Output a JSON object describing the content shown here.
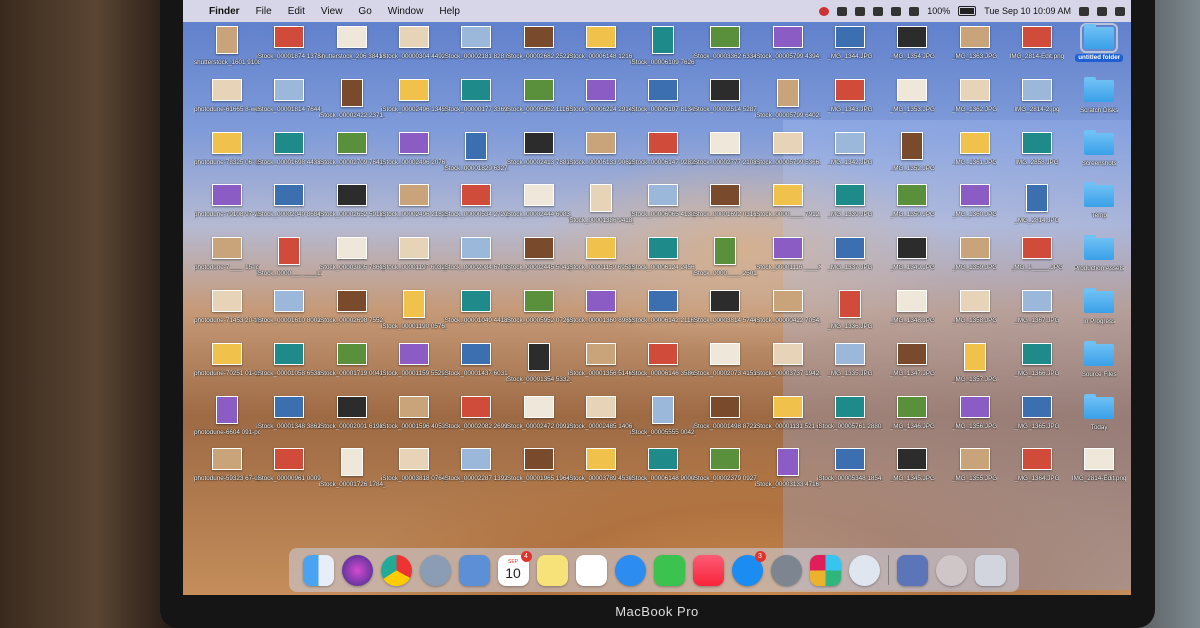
{
  "menubar": {
    "apple": "",
    "app": "Finder",
    "items": [
      "File",
      "Edit",
      "View",
      "Go",
      "Window",
      "Help"
    ],
    "battery": "100%",
    "clock": "Tue Sep 10 10:09 AM"
  },
  "desktop": {
    "columns": [
      [
        "shutterstock_1601 91080.jpg",
        "photodune-61665 8-wood-m.jpg",
        "photodune-78325 06-man...ck-m.jpg",
        "photodune-79108 97-wood-m.jpg",
        "photodune-7____ 15-lcd-t...en-l.jpg",
        "photodune-71453 20-tren...ds-m.jpg",
        "photodune-70251 01-dolla...nd-s.jpg",
        "photodune-6604 091-pc-...rd-s.jpg",
        "photodune-59323 67-olde...st-s.jpg"
      ],
      [
        "iStock_00001874 1378_Full.jpg",
        "iStock_00001814 7644_Large.jpg",
        "iStock_00001698 4438_Full.jpg",
        "iStock_00002040 8684_Full.jpg",
        "iStock_0000___ ____Large.jpg",
        "iStock_00001610 8002_X...arge.jpg",
        "iStock_00001058 6538_X...arge.jpg",
        "iStock_00001348 3862_X...arge.jpg",
        "iStock_00000961 0009_Full.jpg"
      ],
      [
        "shutterstock_206 384140.jpg",
        "iStock_00002422 2371_Large.jpg",
        "iStock_00002709 7641_Full.jpg",
        "iStock_00002652 5918_Full.jpg",
        "iStock_00003005 7860_Large.jpg",
        "iStock_00002698 7552_Full.jpg",
        "iStock_00001719 0041_Large.jpg",
        "iStock_00002001 6198_Full.jpg",
        "iStock_00001726 1784_Full.jpg"
      ],
      [
        "iStock_00000304 4492_Large.jpg",
        "iStock_00002496 1345_X...Large.jpg",
        "iStock_00002496 2076_X...Large.jpg",
        "iStock_00002496 2183_X...Large.jpg",
        "iStock_00001197 6032_Double.jpg",
        "iStock_00001190 0576_Double.jpg",
        "iStock_00001159 5529_Full.jpg",
        "iStock_00001596 4053_Double.jpg",
        "iStock_00003818 0764_Full.jpg"
      ],
      [
        "iStock_00002181 828_Double.jpg",
        "iStock_00000177 3369_Full.jpg",
        "iStock_00001829 6327_Large.jpg",
        "iStock_00000534 2720_Large.jpg",
        "iStock_00002084 6708_Full.jpg",
        "iStock_00001049 4418_Large.jpg",
        "iStock_00001437 6031_X...arge.jpg",
        "iStock_00002082 2699_Double.jpg",
        "iStock_00002287 1392_Full.jpg"
      ],
      [
        "iStock_00002682 2522_Large.jpg",
        "iStock_00005952 1116_Full.jpg",
        "iStock_00002413 7881_Medium.jpg",
        "iStock_00002444 6083_Medium.jpg",
        "iStock_00002445 5043_Medium.jpg",
        "iStock_00005952 0726_Full.jpg",
        "iStock_00001354 5332_Full.jpg",
        "iStock_00002472 0992_Large.jpg",
        "iStock_00001965 1964_Large.jpg"
      ],
      [
        "iStock_00006148 1216_XX...arge.jpg",
        "iStock_00006224 2914_Large.jpg",
        "iStock_00006133 9062_X...arge.jpg",
        "iStock_00001386 9418_X...Large.jpg",
        "iStock_00001159 6958_Large.jpg",
        "iStock_00001360 8985_Large.jpg",
        "iStock_00001356 5146_X...Large.jpg",
        "iStock_00002485 1406_X...Large.jpg",
        "iStock_00003789 4530_Double.jpg"
      ],
      [
        "iStock_00006109 7626_Double.jpg",
        "iStock_00006107 8134_X...arge.jpg",
        "iStock_00006147 9282_Full.jpg",
        "iStock_00006065 4138_Full.jpg",
        "iStock_00006124 2456_Full.jpg",
        "iStock_00006142 2116_Double.jpg",
        "iStock_00006146 3586_Large.jpg",
        "iStock_00005555 0042_Full.jpg",
        "iStock_00006148 9000_X...arge.jpg"
      ],
      [
        "iStock_00003362 6334_Full.jpg",
        "iStock_00002514 5287_X...Large.jpg",
        "iStock_00002777 2108_X...Large.jpg",
        "iStock_00001692 0316_Double.jpg",
        "iStock_0000____ 2501_X...Large.jpg",
        "iStock_00003814 5744_Double.jpg",
        "iStock_00002073 4153_Large.jpg",
        "iStock_00001498 8722_Full.jpg",
        "iStock_00002379 0927_X...Large.jpg"
      ],
      [
        "iStock_00005799 4394_Large.jpg",
        "iStock_00005799 6402_Large.jpg",
        "iStock_00005799 5366_Large.jpg",
        "iStock_0000____ 7912_Large.jpg",
        "iStock_00001116 ____X...arge.jpg",
        "iStock_00000422 7054_Large.jpg",
        "iStock_00003737 1942_Full.jpg",
        "iStock_00001131 521_Large.jpg",
        "iStock_00003133 4716_Full.jpg"
      ],
      [
        "_MG_1344.JPG",
        "_MG_1343.JPG",
        "_MG_1342.JPG",
        "_MG_1339.JPG",
        "_MG_1337.JPG",
        "_MG_1336.JPG",
        "_MG_1335.JPG",
        "iStock_00005761 2880_Double.jpg",
        "iStock_00005348 1854_Full.jpg"
      ],
      [
        "_MG_1354.JPG",
        "_MG_1353.JPG",
        "_MG_1352.JPG",
        "_MG_1350.JPG",
        "_MG_1349.JPG",
        "_MG_1348.JPG",
        "_MG_1347.JPG",
        "_MG_1346.JPG",
        "_MG_1345.JPG"
      ],
      [
        "_MG_1363.JPG",
        "_MG_1362.JPG",
        "_MG_1361.JPG",
        "_MG_1360.JPG",
        "_MG_1359.JPG",
        "_MG_1358.JPG",
        "_MG_1357.JPG",
        "_MG_1356.JPG",
        "_MG_1355.JPG"
      ],
      [
        "IMG_2814-Edit.png",
        "IMG_2814-2.jpg",
        "IMG_2858.JPG",
        "_MG_2814.JPG",
        "_MG_1_____.JPG",
        "_MG_1367.JPG",
        "_MG_1366.JPG",
        "_MG_1365.JPG",
        "_MG_1364.JPG"
      ],
      [
        "untitled folder",
        "Scratch Disks",
        "Screenshots",
        "Temp",
        "Production Assets",
        "In Progress",
        "Source Files",
        "Today",
        "IMG_2814-Edit.png"
      ]
    ]
  },
  "dock": {
    "calendar_month": "SEP",
    "calendar_day": "10",
    "calendar_badge": "4",
    "appstore_badge": "3",
    "apps": [
      "finder",
      "siri",
      "chrome",
      "launchpad",
      "preview",
      "calendar",
      "notes",
      "reminders",
      "messages",
      "facetime",
      "music",
      "app-store",
      "system-preferences",
      "slack",
      "nordvpn",
      "downloads",
      "trash"
    ]
  },
  "device": {
    "brand": "MacBook Pro"
  },
  "colors": {
    "selection": "#1f5fd6",
    "folder": "#3aa0e8",
    "menubar": "#e8e2ec"
  }
}
